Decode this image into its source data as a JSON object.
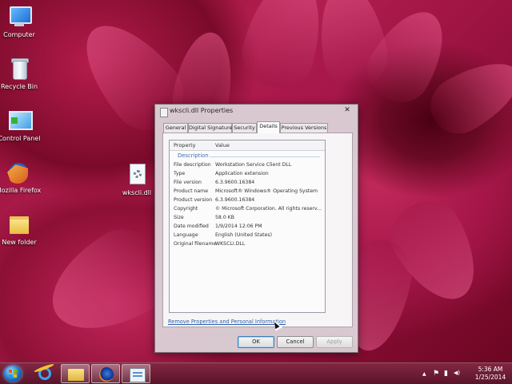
{
  "desktop": {
    "icons": [
      {
        "label": "Computer",
        "icon": "computer-icon"
      },
      {
        "label": "Recycle Bin",
        "icon": "recycle-bin-icon"
      },
      {
        "label": "Control Panel",
        "icon": "control-panel-icon"
      },
      {
        "label": "Mozilla Firefox",
        "icon": "firefox-icon"
      },
      {
        "label": "New folder",
        "icon": "folder-icon"
      },
      {
        "label": "wkscli.dll",
        "icon": "dll-file-icon"
      }
    ]
  },
  "dialog": {
    "title": "wkscli.dll Properties",
    "close_label": "✕",
    "tabs": [
      {
        "label": "General",
        "active": false
      },
      {
        "label": "Digital Signatures",
        "active": false
      },
      {
        "label": "Security",
        "active": false
      },
      {
        "label": "Details",
        "active": true
      },
      {
        "label": "Previous Versions",
        "active": false
      }
    ],
    "list": {
      "col_property": "Property",
      "col_value": "Value",
      "section": "Description",
      "rows": [
        {
          "property": "File description",
          "value": "Workstation Service Client DLL"
        },
        {
          "property": "Type",
          "value": "Application extension"
        },
        {
          "property": "File version",
          "value": "6.3.9600.16384"
        },
        {
          "property": "Product name",
          "value": "Microsoft® Windows® Operating System"
        },
        {
          "property": "Product version",
          "value": "6.3.9600.16384"
        },
        {
          "property": "Copyright",
          "value": "© Microsoft Corporation. All rights reserv..."
        },
        {
          "property": "Size",
          "value": "58.0 KB"
        },
        {
          "property": "Date modified",
          "value": "1/9/2014 12:06 PM"
        },
        {
          "property": "Language",
          "value": "English (United States)"
        },
        {
          "property": "Original filename",
          "value": "WKSCLI.DLL"
        }
      ]
    },
    "remove_link": "Remove Properties and Personal Information",
    "buttons": {
      "ok": "OK",
      "cancel": "Cancel",
      "apply": "Apply"
    }
  },
  "taskbar": {
    "pinned": [
      "start-icon",
      "internet-explorer-icon",
      "file-explorer-icon",
      "firefox-icon",
      "properties-window-icon"
    ],
    "tray": {
      "show_hidden": "▲",
      "flag": "⚑",
      "network": "▮",
      "volume": "◀)"
    },
    "clock": {
      "time": "5:36 AM",
      "date": "1/25/2014"
    }
  },
  "colors": {
    "accent": "#3b6fb0",
    "taskbar": "#6e0b2b",
    "link": "#2d5faa"
  }
}
